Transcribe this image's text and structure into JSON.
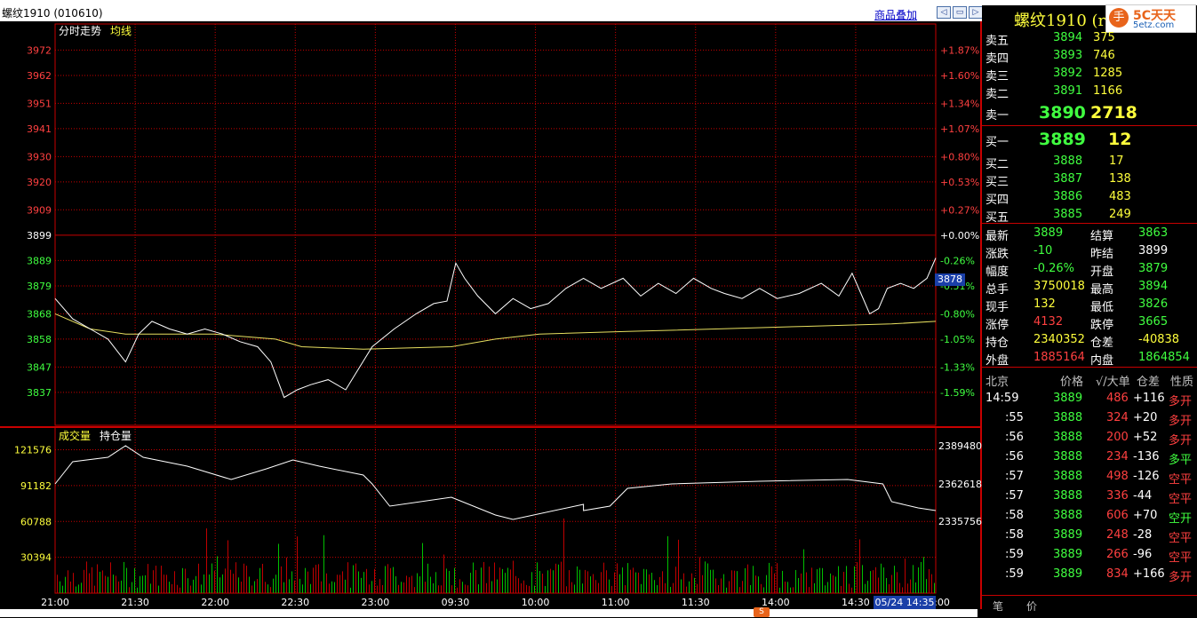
{
  "window": {
    "title": "螺纹1910 (010610)",
    "overlay_label": "商品叠加",
    "nav_buttons": [
      "◁",
      "▭",
      "▷",
      "▭"
    ]
  },
  "header": {
    "name": "螺纹1910 (r",
    "logo_char": "手",
    "logo_text_main": "5C天天",
    "logo_text_sub": "5etz.com"
  },
  "chart": {
    "labels": {
      "trend": "分时走势",
      "avg": "均线",
      "volume": "成交量",
      "oi": "持仓量"
    },
    "current_price_tag": "3878",
    "time_tag": "05/24 14:35"
  },
  "colors": {
    "grid": "#c80000",
    "up": "#ff4040",
    "down": "#40ff40",
    "price_line": "#ffffff",
    "avg_line": "#e8e060",
    "volume_bar": "#00c000",
    "accent_yellow": "#ffff3c"
  },
  "chart_data": {
    "type": "line",
    "price_axis": {
      "ticks": [
        3972,
        3962,
        3951,
        3941,
        3930,
        3920,
        3909,
        3899,
        3889,
        3879,
        3868,
        3858,
        3847,
        3837
      ],
      "pct": [
        "+1.87%",
        "+1.60%",
        "+1.34%",
        "+1.07%",
        "+0.80%",
        "+0.53%",
        "+0.27%",
        "+0.00%",
        "-0.26%",
        "-0.51%",
        "-0.80%",
        "-1.05%",
        "-1.33%",
        "-1.59%"
      ],
      "range": [
        3831,
        3976
      ],
      "base": 3899
    },
    "time_axis": [
      "21:00",
      "21:30",
      "22:00",
      "22:30",
      "23:00",
      "09:30",
      "10:00",
      "11:00",
      "11:30",
      "14:00",
      "14:30",
      "15:00"
    ],
    "price_series": [
      [
        0,
        3874
      ],
      [
        0.02,
        3866
      ],
      [
        0.04,
        3862
      ],
      [
        0.06,
        3858
      ],
      [
        0.08,
        3849
      ],
      [
        0.095,
        3860
      ],
      [
        0.11,
        3865
      ],
      [
        0.13,
        3862
      ],
      [
        0.15,
        3860
      ],
      [
        0.17,
        3862
      ],
      [
        0.19,
        3860
      ],
      [
        0.21,
        3857
      ],
      [
        0.23,
        3855
      ],
      [
        0.245,
        3849
      ],
      [
        0.26,
        3835
      ],
      [
        0.275,
        3838
      ],
      [
        0.29,
        3840
      ],
      [
        0.31,
        3842
      ],
      [
        0.33,
        3838
      ],
      [
        0.36,
        3855
      ],
      [
        0.385,
        3862
      ],
      [
        0.41,
        3868
      ],
      [
        0.43,
        3872
      ],
      [
        0.445,
        3873
      ],
      [
        0.455,
        3888
      ],
      [
        0.465,
        3882
      ],
      [
        0.48,
        3875
      ],
      [
        0.5,
        3868
      ],
      [
        0.52,
        3874
      ],
      [
        0.54,
        3870
      ],
      [
        0.56,
        3872
      ],
      [
        0.58,
        3878
      ],
      [
        0.6,
        3882
      ],
      [
        0.62,
        3878
      ],
      [
        0.645,
        3882
      ],
      [
        0.665,
        3875
      ],
      [
        0.685,
        3880
      ],
      [
        0.705,
        3876
      ],
      [
        0.725,
        3882
      ],
      [
        0.745,
        3878
      ],
      [
        0.76,
        3876
      ],
      [
        0.78,
        3874
      ],
      [
        0.8,
        3878
      ],
      [
        0.82,
        3874
      ],
      [
        0.845,
        3876
      ],
      [
        0.87,
        3880
      ],
      [
        0.89,
        3875
      ],
      [
        0.905,
        3884
      ],
      [
        0.915,
        3876
      ],
      [
        0.925,
        3868
      ],
      [
        0.935,
        3870
      ],
      [
        0.945,
        3878
      ],
      [
        0.96,
        3880
      ],
      [
        0.975,
        3878
      ],
      [
        0.99,
        3882
      ],
      [
        1.0,
        3890
      ]
    ],
    "avg_series": [
      [
        0,
        3868
      ],
      [
        0.04,
        3862
      ],
      [
        0.08,
        3860
      ],
      [
        0.12,
        3860
      ],
      [
        0.18,
        3860
      ],
      [
        0.25,
        3858
      ],
      [
        0.28,
        3855
      ],
      [
        0.35,
        3854
      ],
      [
        0.45,
        3855
      ],
      [
        0.5,
        3858
      ],
      [
        0.55,
        3860
      ],
      [
        0.65,
        3861
      ],
      [
        0.75,
        3862
      ],
      [
        0.85,
        3863
      ],
      [
        0.95,
        3864
      ],
      [
        1.0,
        3865
      ]
    ],
    "volume_axis": {
      "ticks": [
        121576,
        91182,
        60788,
        30394
      ],
      "max": 125000
    },
    "oi_axis": {
      "ticks": [
        2389480,
        2362618,
        2335756
      ]
    }
  },
  "orderbook": {
    "asks": [
      {
        "label": "卖五",
        "price": "3894",
        "vol": "375"
      },
      {
        "label": "卖四",
        "price": "3893",
        "vol": "746"
      },
      {
        "label": "卖三",
        "price": "3892",
        "vol": "1285"
      },
      {
        "label": "卖二",
        "price": "3891",
        "vol": "1166"
      },
      {
        "label": "卖一",
        "price": "3890",
        "vol": "2718"
      }
    ],
    "bids": [
      {
        "label": "买一",
        "price": "3889",
        "vol": "12"
      },
      {
        "label": "买二",
        "price": "3888",
        "vol": "17"
      },
      {
        "label": "买三",
        "price": "3887",
        "vol": "138"
      },
      {
        "label": "买四",
        "price": "3886",
        "vol": "483"
      },
      {
        "label": "买五",
        "price": "3885",
        "vol": "249"
      }
    ]
  },
  "stats": [
    {
      "l1": "最新",
      "v1": "3889",
      "c1": "down",
      "l2": "结算",
      "v2": "3863",
      "c2": "down"
    },
    {
      "l1": "涨跌",
      "v1": "-10",
      "c1": "down",
      "l2": "昨结",
      "v2": "3899",
      "c2": "white"
    },
    {
      "l1": "幅度",
      "v1": "-0.26%",
      "c1": "down",
      "l2": "开盘",
      "v2": "3879",
      "c2": "down"
    },
    {
      "l1": "总手",
      "v1": "3750018",
      "c1": "yellow",
      "l2": "最高",
      "v2": "3894",
      "c2": "down"
    },
    {
      "l1": "现手",
      "v1": "132",
      "c1": "yellow",
      "l2": "最低",
      "v2": "3826",
      "c2": "down"
    },
    {
      "l1": "涨停",
      "v1": "4132",
      "c1": "up",
      "l2": "跌停",
      "v2": "3665",
      "c2": "down"
    },
    {
      "l1": "持仓",
      "v1": "2340352",
      "c1": "yellow",
      "l2": "仓差",
      "v2": "-40838",
      "c2": "yellow"
    },
    {
      "l1": "外盘",
      "v1": "1885164",
      "c1": "up",
      "l2": "内盘",
      "v2": "1864854",
      "c2": "down"
    }
  ],
  "ticks_header": {
    "c1": "北京",
    "c2": "价格",
    "c3": "√/大单",
    "c4": "仓差",
    "c5": "性质"
  },
  "ticks": [
    {
      "t": "14:59",
      "p": "3889",
      "v": "486",
      "d": "+116",
      "n": "多开",
      "nc": "up"
    },
    {
      "t": ":55",
      "p": "3888",
      "v": "324",
      "d": "+20",
      "n": "多开",
      "nc": "up"
    },
    {
      "t": ":56",
      "p": "3888",
      "v": "200",
      "d": "+52",
      "n": "多开",
      "nc": "up"
    },
    {
      "t": ":56",
      "p": "3888",
      "v": "234",
      "d": "-136",
      "n": "多平",
      "nc": "down"
    },
    {
      "t": ":57",
      "p": "3888",
      "v": "498",
      "d": "-126",
      "n": "空平",
      "nc": "up"
    },
    {
      "t": ":57",
      "p": "3888",
      "v": "336",
      "d": "-44",
      "n": "空平",
      "nc": "up"
    },
    {
      "t": ":58",
      "p": "3888",
      "v": "606",
      "d": "+70",
      "n": "空开",
      "nc": "down"
    },
    {
      "t": ":58",
      "p": "3889",
      "v": "248",
      "d": "-28",
      "n": "空平",
      "nc": "up"
    },
    {
      "t": ":59",
      "p": "3889",
      "v": "266",
      "d": "-96",
      "n": "空平",
      "nc": "up"
    },
    {
      "t": ":59",
      "p": "3889",
      "v": "834",
      "d": "+166",
      "n": "多开",
      "nc": "up"
    }
  ],
  "tabs": [
    "笔",
    "价"
  ]
}
